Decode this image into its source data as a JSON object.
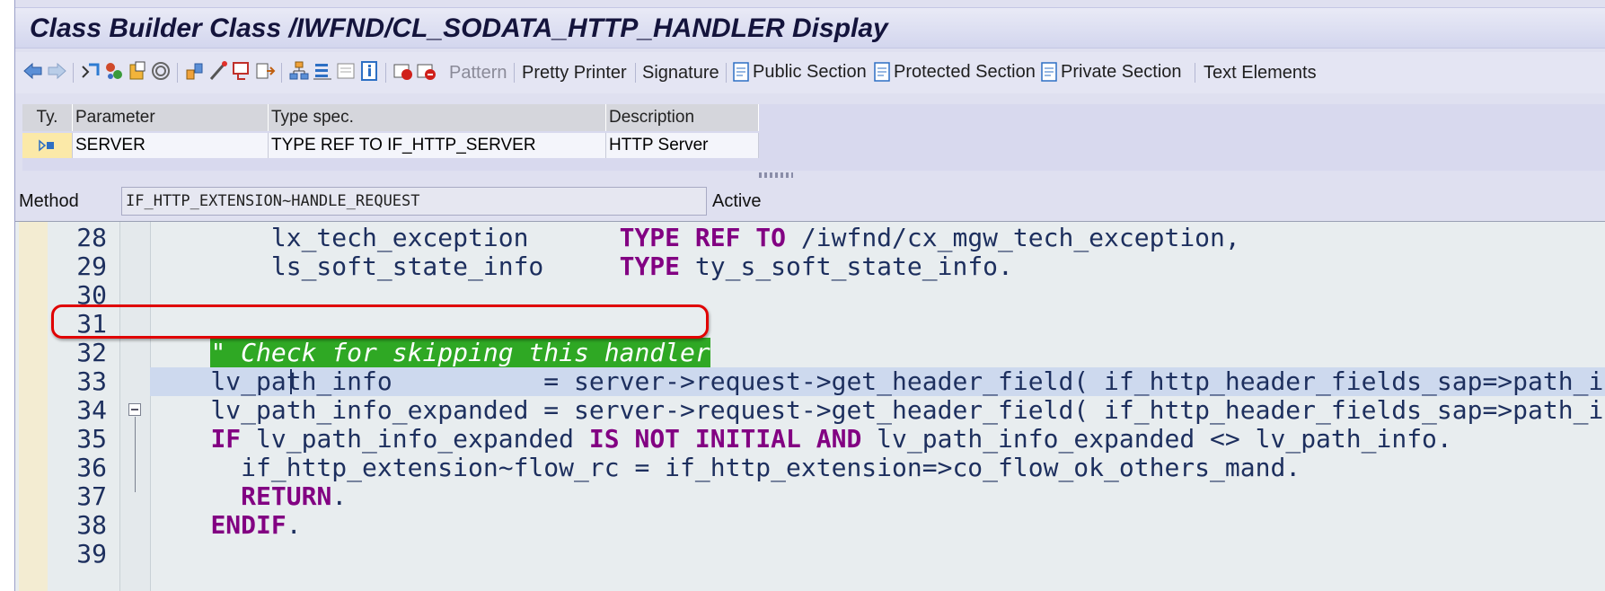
{
  "window": {
    "title": "Class Builder Class /IWFND/CL_SODATA_HTTP_HANDLER Display"
  },
  "toolbar": {
    "icons": [
      "back-arrow-icon",
      "forward-arrow-icon",
      "other-object-icon",
      "display-change-icon",
      "active-inactive-icon",
      "check-icon",
      "activate-icon",
      "where-used-icon",
      "object-list-icon",
      "display-navigation-window-icon",
      "enhance-icon",
      "breakpoint-icon",
      "hierarchy-icon",
      "information-icon",
      "session-breakpoint-icon",
      "external-breakpoint-icon"
    ],
    "pattern_label": "Pattern",
    "pretty_printer_label": "Pretty Printer",
    "signature_label": "Signature",
    "public_section_label": "Public Section",
    "protected_section_label": "Protected Section",
    "private_section_label": "Private Section",
    "text_elements_label": "Text Elements"
  },
  "params": {
    "headers": [
      "Ty.",
      "Parameter",
      "Type spec.",
      "Description"
    ],
    "rows": [
      {
        "ty_icon": "importing-parameter-icon",
        "parameter": "SERVER",
        "type_spec": "TYPE REF TO IF_HTTP_SERVER",
        "description": "HTTP Server"
      }
    ]
  },
  "method": {
    "label": "Method",
    "name": "IF_HTTP_EXTENSION~HANDLE_REQUEST",
    "status": "Active"
  },
  "editor": {
    "highlight_color": "#2fa824",
    "keyword_color": "#820082",
    "lines": [
      {
        "n": "28",
        "a": "        lx_tech_exception      ",
        "k1": "TYPE REF TO",
        "b": " /iwfnd/cx_mgw_tech_exception,"
      },
      {
        "n": "29",
        "a": "        ls_soft_state_info     ",
        "k1": "TYPE",
        "b": " ty_s_soft_state_info."
      },
      {
        "n": "30"
      },
      {
        "n": "31"
      },
      {
        "n": "32",
        "comment": "\" Check for skipping this handler"
      },
      {
        "n": "33",
        "a": "    lv_path_info          = server->request->get_header_field( if_http_header_fields_sap=>path_info )."
      },
      {
        "n": "34",
        "a": "    lv_path_info_expanded = server->request->get_header_field( if_http_header_fields_sap=>path_info_expanded )."
      },
      {
        "n": "35",
        "k1": "IF",
        "a": " lv_path_info_expanded ",
        "k2": "IS NOT INITIAL AND",
        "b": " lv_path_info_expanded <> lv_path_info."
      },
      {
        "n": "36",
        "a": "      if_http_extension~flow_rc = if_http_extension=>co_flow_ok_others_mand."
      },
      {
        "n": "37",
        "k1": "RETURN",
        "b": "."
      },
      {
        "n": "38",
        "k1": "ENDIF",
        "b": "."
      },
      {
        "n": "39"
      }
    ]
  }
}
